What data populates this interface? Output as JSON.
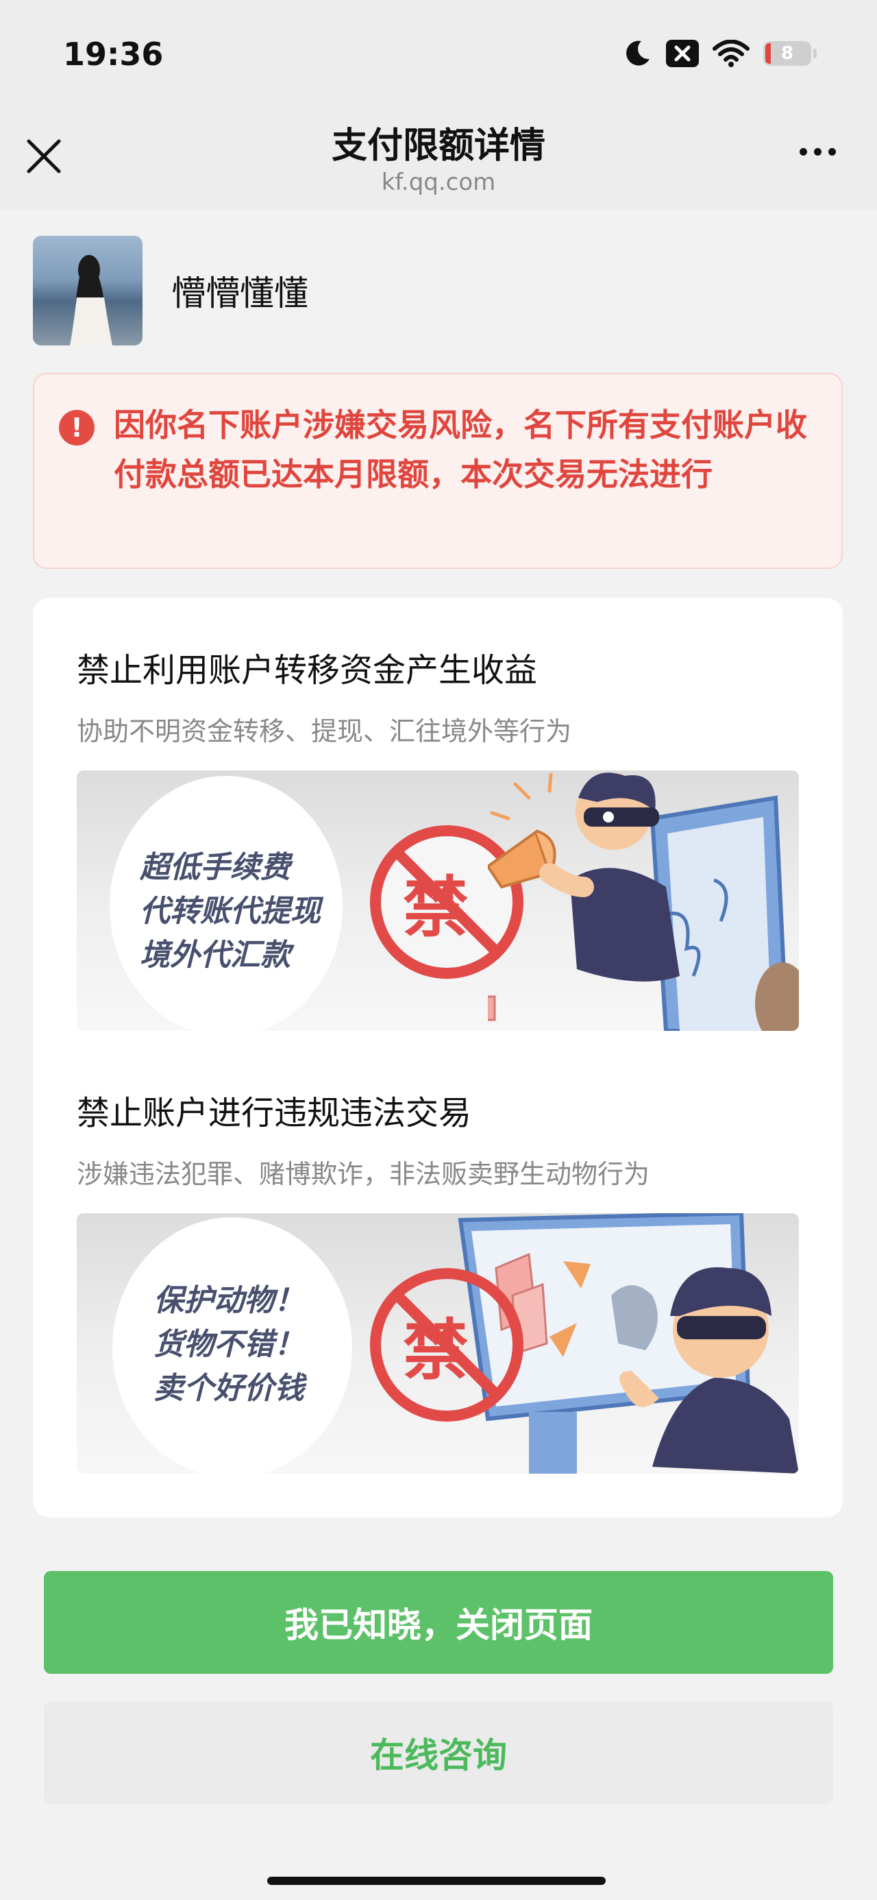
{
  "status_bar": {
    "time": "19:36",
    "battery_level": "8",
    "icons": [
      "moon-icon",
      "notification-mute-icon",
      "wifi-icon",
      "battery-icon"
    ]
  },
  "nav": {
    "title": "支付限额详情",
    "subtitle": "kf.qq.com",
    "close_icon": "close-icon",
    "more_icon": "more-icon"
  },
  "profile": {
    "name": "懵懵懂懂"
  },
  "warning": {
    "icon": "exclamation-icon",
    "text": "因你名下账户涉嫌交易风险，名下所有支付账户收付款总额已达本月限额，本次交易无法进行",
    "color": "#e0463d"
  },
  "sections": [
    {
      "title": "禁止利用账户转移资金产生收益",
      "description": "协助不明资金转移、提现、汇往境外等行为",
      "banner": {
        "lines": [
          "超低手续费",
          "代转账代提现",
          "境外代汇款"
        ],
        "forbid_label": "禁"
      }
    },
    {
      "title": "禁止账户进行违规违法交易",
      "description": "涉嫌违法犯罪、赌博欺诈，非法贩卖野生动物行为",
      "banner": {
        "lines": [
          "保护动物！",
          "货物不错！",
          "卖个好价钱"
        ],
        "forbid_label": "禁"
      }
    }
  ],
  "buttons": {
    "primary": "我已知晓，关闭页面",
    "secondary": "在线咨询"
  },
  "colors": {
    "accent_green": "#5cc168",
    "danger_red": "#e0463d"
  }
}
